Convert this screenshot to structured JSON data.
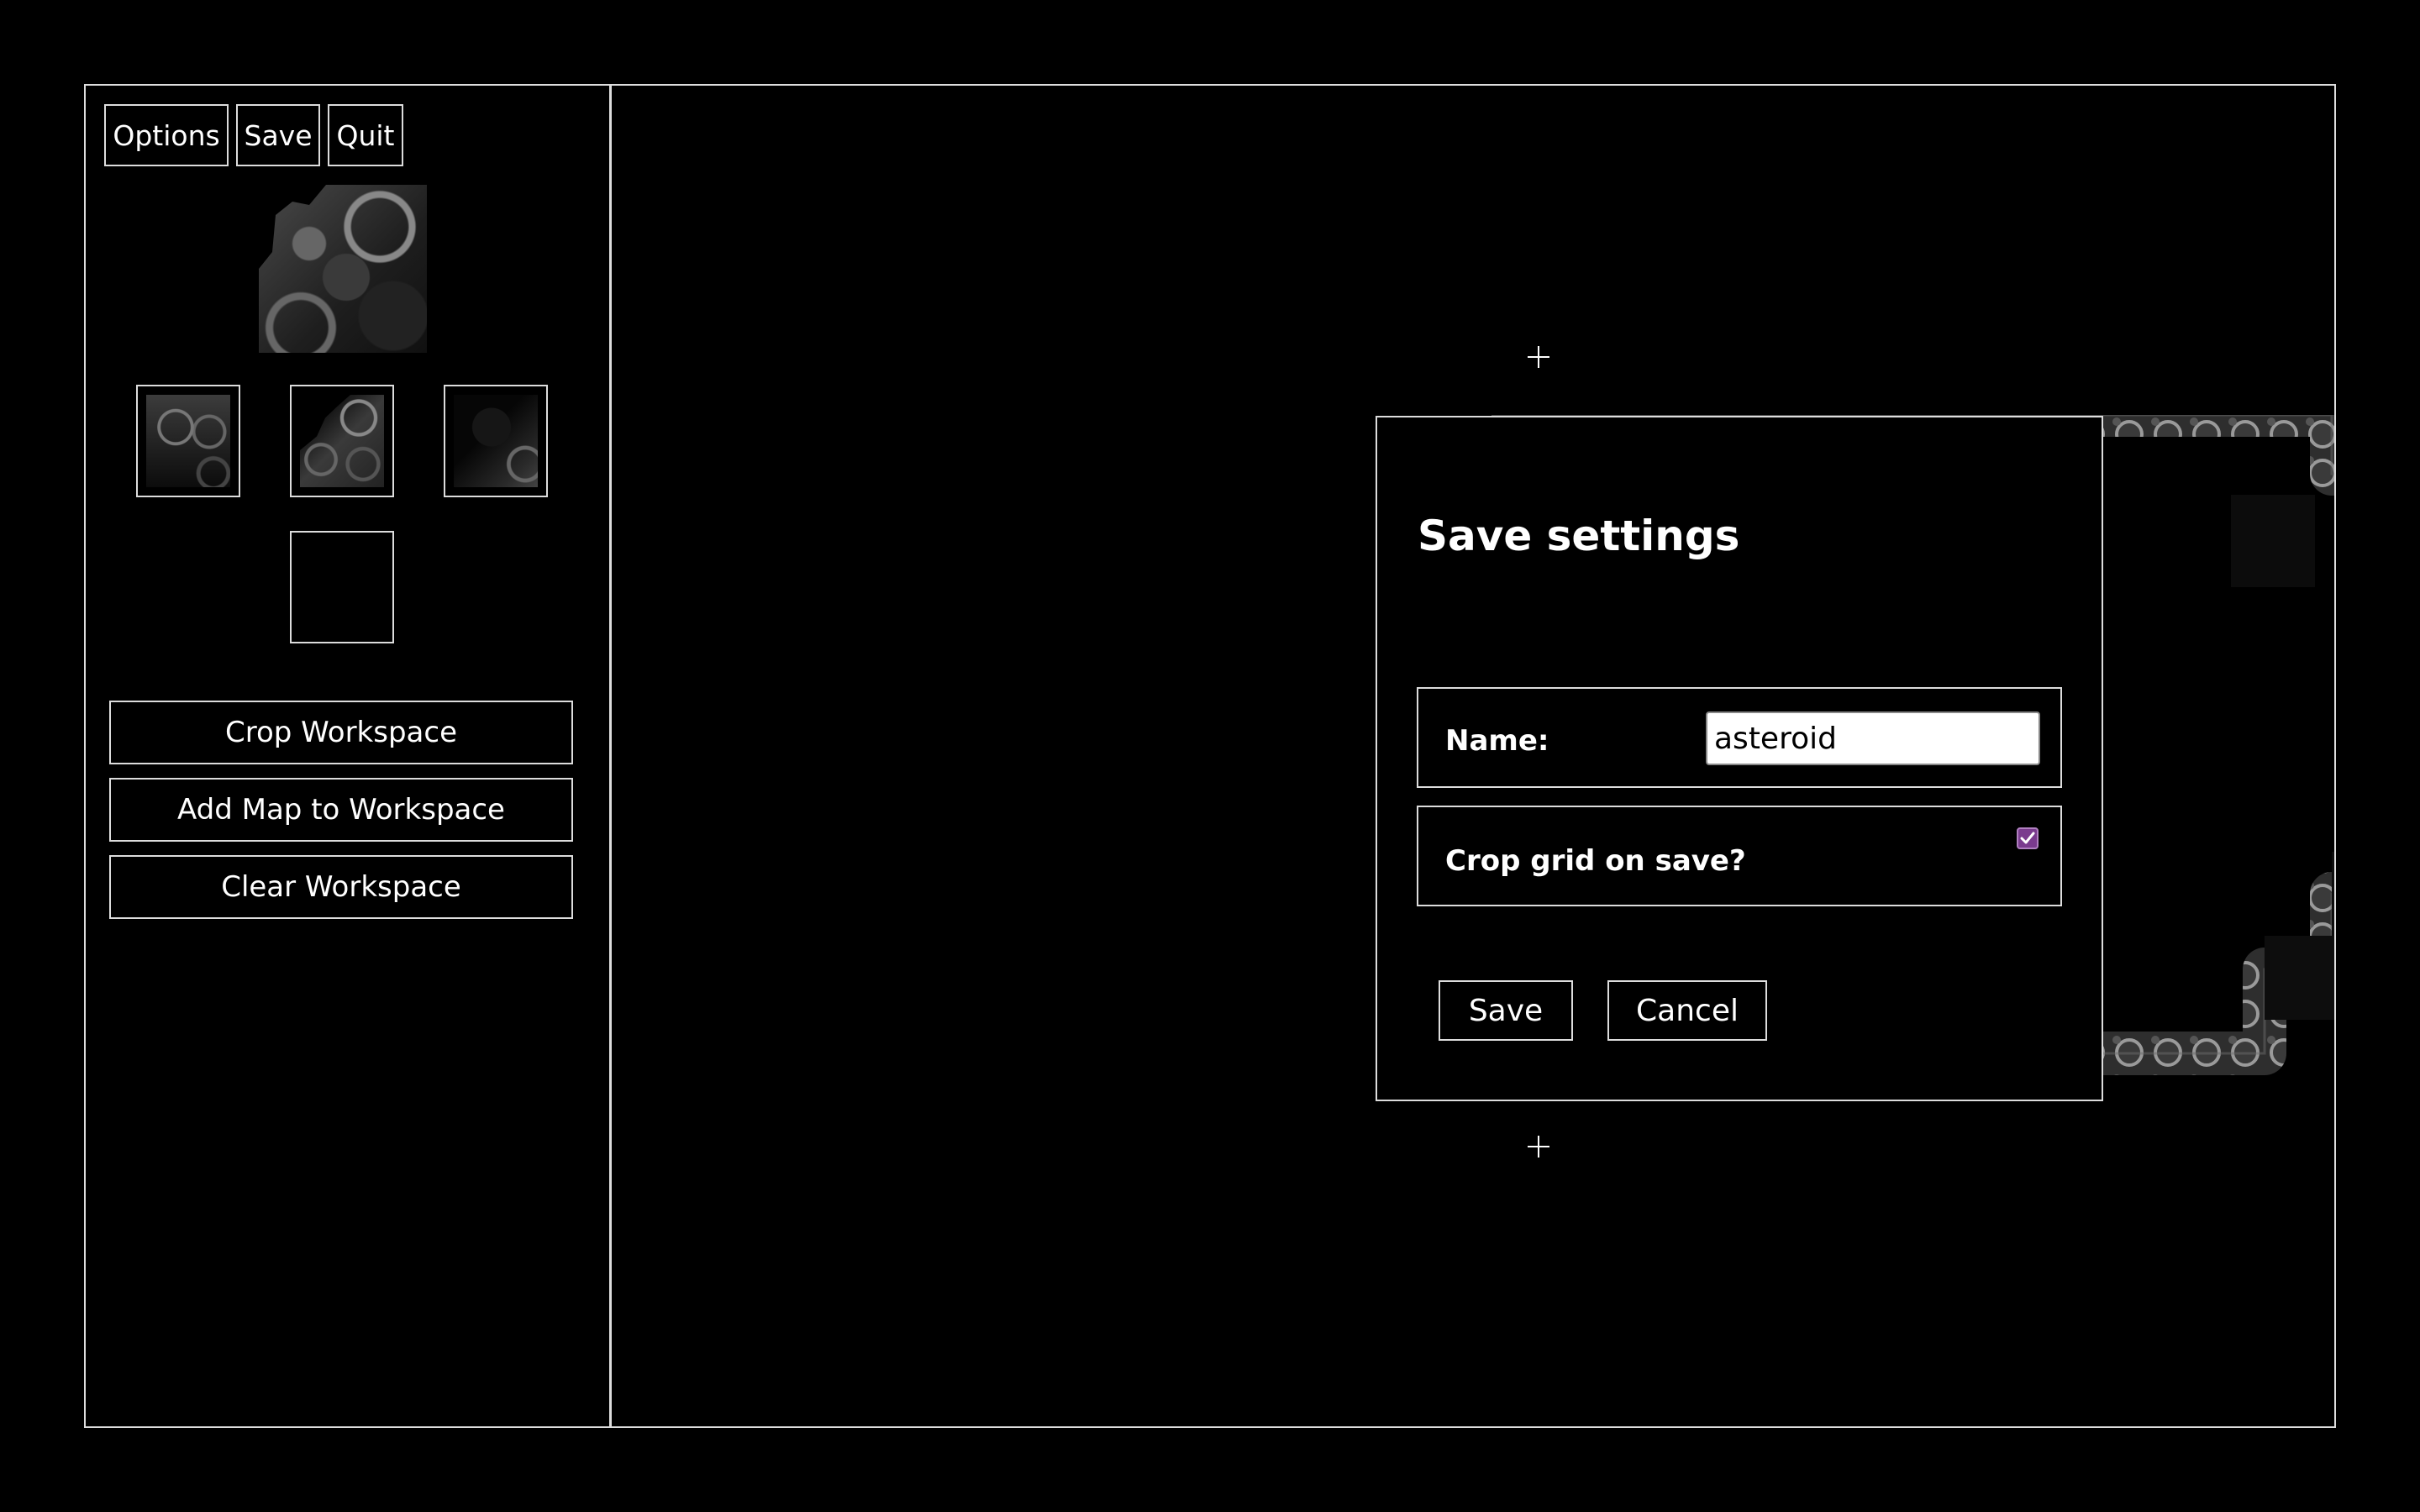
{
  "toolbar": {
    "options_label": "Options",
    "save_label": "Save",
    "quit_label": "Quit"
  },
  "sidebar": {
    "selected_tile": "asteroid-tile-preview",
    "tiles": [
      "asteroid-tile-1",
      "asteroid-tile-2",
      "asteroid-tile-3",
      "empty-tile"
    ],
    "crop_workspace_label": "Crop Workspace",
    "add_map_label": "Add Map to Workspace",
    "clear_workspace_label": "Clear Workspace"
  },
  "dialog": {
    "title": "Save settings",
    "name_label": "Name:",
    "name_value": "asteroid",
    "crop_label": "Crop grid on save?",
    "crop_checked": true,
    "save_label": "Save",
    "cancel_label": "Cancel"
  },
  "colors": {
    "background": "#000000",
    "border": "#dddddd",
    "checkbox_accent": "#7a3b8e"
  }
}
